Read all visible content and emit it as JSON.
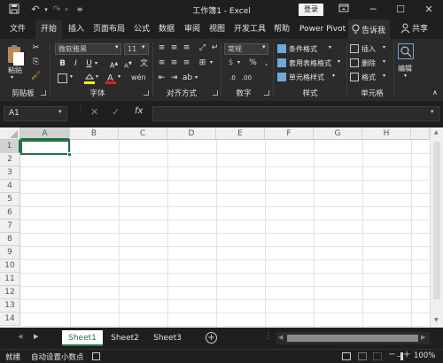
{
  "titlebar": {
    "title": "工作簿1  -  Excel",
    "login": "登录",
    "quick_access": [
      "save-icon",
      "undo-icon",
      "redo-icon",
      "customize-icon"
    ]
  },
  "tabs": [
    "文件",
    "开始",
    "插入",
    "页面布局",
    "公式",
    "数据",
    "审阅",
    "视图",
    "开发工具",
    "帮助",
    "Power Pivot"
  ],
  "active_tab": "开始",
  "tell_me": "告诉我",
  "share": "共享",
  "ribbon": {
    "clipboard": {
      "paste": "粘贴",
      "label": "剪贴板"
    },
    "font": {
      "name": "微软雅黑",
      "size": "11",
      "label": "字体",
      "bold": "B",
      "italic": "I",
      "underline": "U"
    },
    "alignment": {
      "label": "对齐方式"
    },
    "number": {
      "format": "常规",
      "label": "数字",
      "percent": "%"
    },
    "styles": {
      "conditional": "条件格式",
      "table": "套用表格格式",
      "cell_styles": "单元格样式",
      "label": "样式"
    },
    "cells": {
      "insert": "插入",
      "delete": "删除",
      "format": "格式",
      "label": "单元格"
    },
    "editing": {
      "label": "编辑"
    }
  },
  "formula_bar": {
    "name_box": "A1",
    "fx": "fx",
    "value": ""
  },
  "grid": {
    "columns": [
      "A",
      "B",
      "C",
      "D",
      "E",
      "F",
      "G",
      "H"
    ],
    "rows": [
      "1",
      "2",
      "3",
      "4",
      "5",
      "6",
      "7",
      "8",
      "9",
      "10",
      "11",
      "12",
      "13",
      "14"
    ],
    "selected_cell": "A1"
  },
  "sheets": [
    "Sheet1",
    "Sheet2",
    "Sheet3"
  ],
  "active_sheet": "Sheet1",
  "status": {
    "mode": "就绪",
    "auto_decimal": "自动设置小数点",
    "zoom": "100%"
  },
  "colors": {
    "accent": "#217346",
    "dark_bg": "#1f1f1f",
    "ribbon_bg": "#2b2b2b"
  }
}
